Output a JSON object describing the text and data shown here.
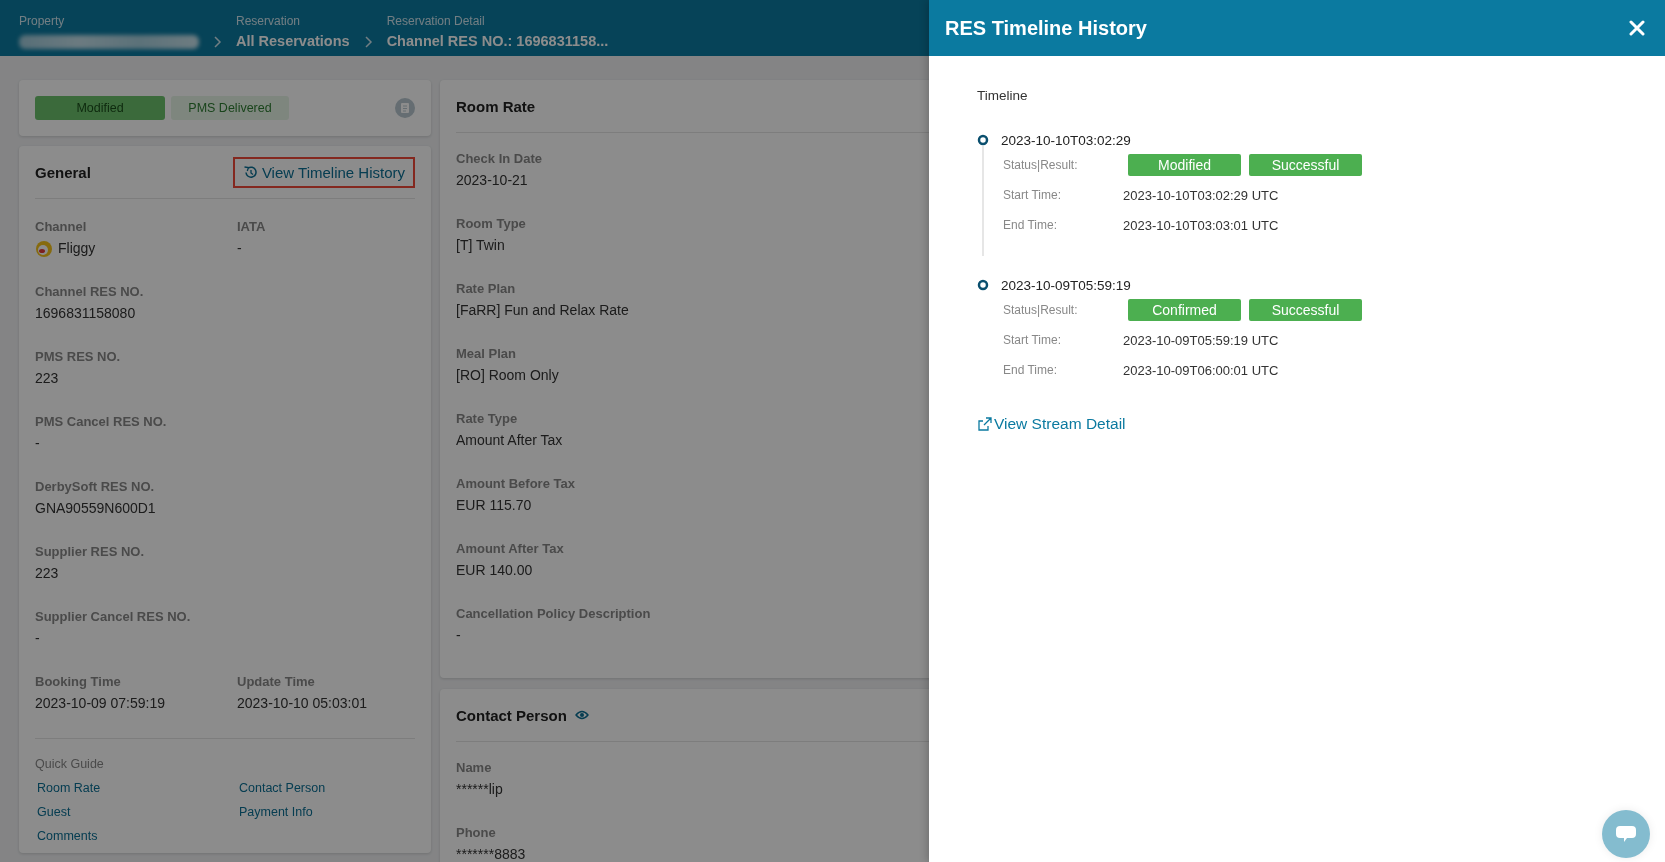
{
  "breadcrumbs": [
    {
      "label": "Property",
      "kind": "redacted"
    },
    {
      "label": "Reservation",
      "value": "All Reservations",
      "kind": "link"
    },
    {
      "label": "Reservation Detail",
      "value": "Channel RES NO.: 1696831158...",
      "kind": "current"
    }
  ],
  "status_badges": [
    {
      "label": "Modified",
      "kind": "primary"
    },
    {
      "label": "PMS Delivered",
      "kind": "secondary"
    }
  ],
  "general": {
    "title": "General",
    "timeline_link": "View Timeline History",
    "highlighted": true,
    "rows": [
      [
        {
          "label": "Channel",
          "value": "Fliggy",
          "kind": "channel"
        },
        {
          "label": "IATA",
          "value": "-"
        }
      ],
      [
        {
          "label": "Channel RES NO.",
          "value": "1696831158080"
        }
      ],
      [
        {
          "label": "PMS RES NO.",
          "value": "223"
        }
      ],
      [
        {
          "label": "PMS Cancel RES NO.",
          "value": "-"
        }
      ],
      [
        {
          "label": "DerbySoft RES NO.",
          "value": "GNA90559N600D1"
        }
      ],
      [
        {
          "label": "Supplier RES NO.",
          "value": "223"
        }
      ],
      [
        {
          "label": "Supplier Cancel RES NO.",
          "value": "-"
        }
      ],
      [
        {
          "label": "Booking Time",
          "value": "2023-10-09 07:59:19"
        },
        {
          "label": "Update Time",
          "value": "2023-10-10 05:03:01"
        }
      ]
    ],
    "quick_guide": {
      "title": "Quick Guide",
      "links": [
        "Room Rate",
        "Contact Person",
        "Guest",
        "Payment Info",
        "Comments"
      ]
    }
  },
  "room_rate": {
    "title": "Room Rate",
    "fields": [
      {
        "label": "Check In Date",
        "value": "2023-10-21"
      },
      {
        "label": "Room Type",
        "value": "[T] Twin"
      },
      {
        "label": "Rate Plan",
        "value": "[FaRR] Fun and Relax Rate"
      },
      {
        "label": "Meal Plan",
        "value": "[RO] Room Only"
      },
      {
        "label": "Rate Type",
        "value": "Amount After Tax"
      },
      {
        "label": "Amount Before Tax",
        "value": "EUR 115.70"
      },
      {
        "label": "Amount After Tax",
        "value": "EUR 140.00"
      },
      {
        "label": "Cancellation Policy Description",
        "value": "-"
      }
    ]
  },
  "contact_person": {
    "title": "Contact Person",
    "fields": [
      {
        "label": "Name",
        "value": "******lip"
      },
      {
        "label": "Phone",
        "value": "*******8883"
      }
    ]
  },
  "drawer": {
    "title": "RES Timeline History",
    "section": "Timeline",
    "events": [
      {
        "time": "2023-10-10T03:02:29",
        "status_label": "Status|Result:",
        "status": "Modified",
        "result": "Successful",
        "start_label": "Start Time:",
        "start": "2023-10-10T03:02:29 UTC",
        "end_label": "End Time:",
        "end": "2023-10-10T03:03:01 UTC"
      },
      {
        "time": "2023-10-09T05:59:19",
        "status_label": "Status|Result:",
        "status": "Confirmed",
        "result": "Successful",
        "start_label": "Start Time:",
        "start": "2023-10-09T05:59:19 UTC",
        "end_label": "End Time:",
        "end": "2023-10-09T06:00:01 UTC"
      }
    ],
    "link": "View Stream Detail"
  }
}
